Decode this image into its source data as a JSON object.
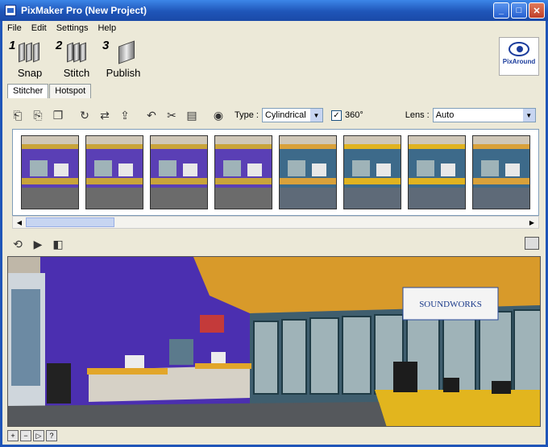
{
  "window": {
    "title": "PixMaker Pro (New Project)"
  },
  "menu": [
    "File",
    "Edit",
    "Settings",
    "Help"
  ],
  "steps": [
    {
      "num": "1",
      "label": "Snap"
    },
    {
      "num": "2",
      "label": "Stitch"
    },
    {
      "num": "3",
      "label": "Publish"
    }
  ],
  "logo": {
    "text": "PixAround"
  },
  "tabs": [
    "Stitcher",
    "Hotspot"
  ],
  "toolbar": {
    "type_label": "Type :",
    "type_value": "Cylindrical",
    "checkbox_label": "360°",
    "checkbox_checked": true,
    "lens_label": "Lens :",
    "lens_value": "Auto"
  },
  "thumbnails": [
    {
      "wall": "#5a3fb5",
      "floor": "#6b6b6b",
      "accent": "#c9a43a"
    },
    {
      "wall": "#5a3fb5",
      "floor": "#6b6b6b",
      "accent": "#c9a43a"
    },
    {
      "wall": "#5a3fb5",
      "floor": "#6b6b6b",
      "accent": "#c9a43a"
    },
    {
      "wall": "#5a3fb5",
      "floor": "#6b6b6b",
      "accent": "#c9a43a"
    },
    {
      "wall": "#3d6a8a",
      "floor": "#5e6a78",
      "accent": "#d9a13a"
    },
    {
      "wall": "#3d6a8a",
      "floor": "#5e6a78",
      "accent": "#e0b320"
    },
    {
      "wall": "#3d6a8a",
      "floor": "#5e6a78",
      "accent": "#e0b320"
    },
    {
      "wall": "#3d6a8a",
      "floor": "#5e6a78",
      "accent": "#d9a13a"
    }
  ],
  "pano": {
    "sign_text": "SOUNDWORKS"
  },
  "colors": {
    "titlebar": "#1f55b8",
    "wall_purple": "#4b2fb0",
    "ceiling_orange": "#d89a2a",
    "counter_yellow": "#e2b51e"
  }
}
